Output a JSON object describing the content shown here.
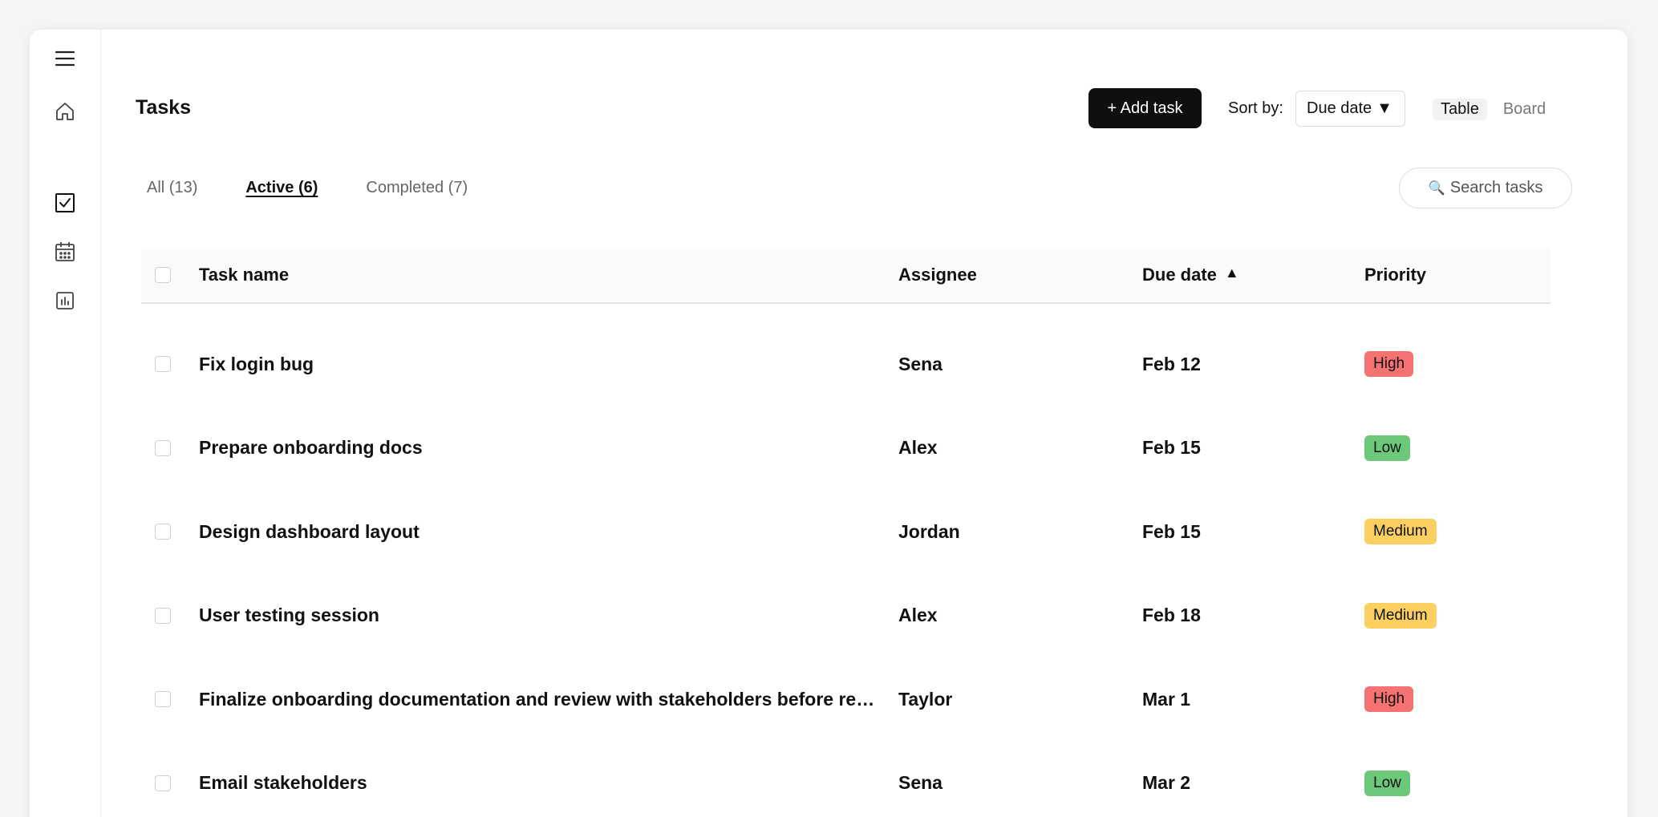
{
  "sidebar": {
    "icons": [
      "menu-icon",
      "home-icon",
      "checkbox-icon",
      "calendar-icon",
      "chart-icon"
    ]
  },
  "header": {
    "title": "Tasks",
    "add_label": "+ Add task",
    "sort_label": "Sort by:",
    "sort_value": "Due date",
    "view_table": "Table",
    "view_board": "Board"
  },
  "tabs": [
    {
      "label": "All (13)"
    },
    {
      "label": "Active (6)"
    },
    {
      "label": "Completed (7)"
    }
  ],
  "search": {
    "placeholder": "Search tasks"
  },
  "table": {
    "columns": {
      "name": "Task name",
      "assignee": "Assignee",
      "due": "Due date",
      "priority": "Priority"
    },
    "rows": [
      {
        "name": "Fix login bug",
        "assignee": "Sena",
        "due": "Feb 12",
        "priority": "High"
      },
      {
        "name": "Prepare onboarding docs",
        "assignee": "Alex",
        "due": "Feb 15",
        "priority": "Low"
      },
      {
        "name": "Design dashboard layout",
        "assignee": "Jordan",
        "due": "Feb 15",
        "priority": "Medium"
      },
      {
        "name": "User testing session",
        "assignee": "Alex",
        "due": "Feb 18",
        "priority": "Medium"
      },
      {
        "name": "Finalize onboarding documentation and review with stakeholders before release",
        "assignee": "Taylor",
        "due": "Mar 1",
        "priority": "High"
      },
      {
        "name": "Email stakeholders",
        "assignee": "Sena",
        "due": "Mar 2",
        "priority": "Low"
      }
    ]
  },
  "colors": {
    "high": "#f47272",
    "low": "#6dc97a",
    "medium": "#fcd060",
    "button_bg": "#0f0f0f"
  }
}
